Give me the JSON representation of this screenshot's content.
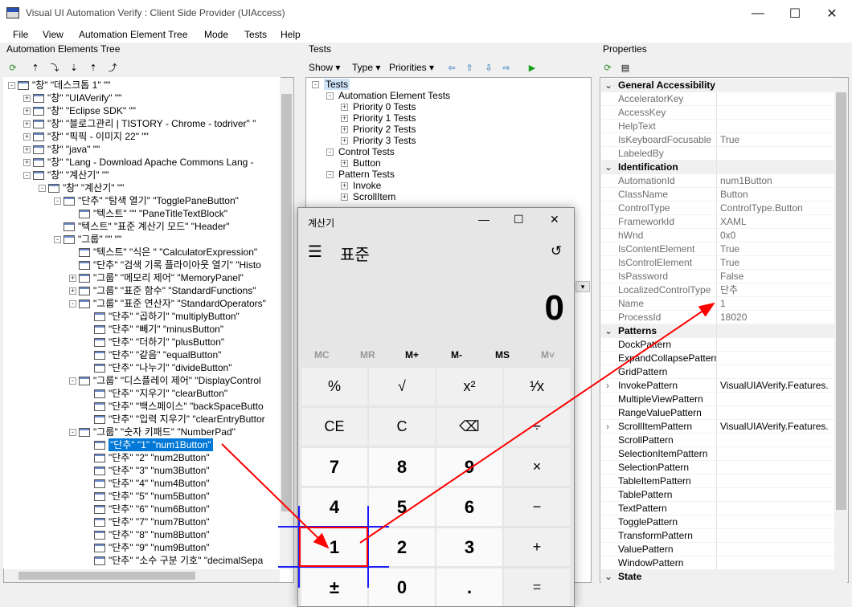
{
  "window": {
    "title": "Visual UI Automation Verify : Client Side Provider (UIAccess)"
  },
  "menu": [
    "File",
    "View",
    "Automation Element Tree",
    "Mode",
    "Tests",
    "Help"
  ],
  "panes": {
    "tree_title": "Automation Elements Tree",
    "tests_title": "Tests",
    "props_title": "Properties"
  },
  "tests_toolbar": {
    "show": "Show",
    "type": "Type",
    "priorities": "Priorities"
  },
  "tree": [
    {
      "text": "\"창\" \"데스크톱 1\" \"\"",
      "level": 0,
      "exp": "-"
    },
    {
      "text": "\"창\" \"UIAVerify\" \"\"",
      "level": 1,
      "exp": "+"
    },
    {
      "text": "\"창\" \"Eclipse SDK\" \"\"",
      "level": 1,
      "exp": "+"
    },
    {
      "text": "\"창\" \"블로그관리 | TISTORY - Chrome - todriver\" \"",
      "level": 1,
      "exp": "+"
    },
    {
      "text": "\"창\" \"픽픽 - 이미지 22\" \"\"",
      "level": 1,
      "exp": "+"
    },
    {
      "text": "\"창\" \"java\" \"\"",
      "level": 1,
      "exp": "+"
    },
    {
      "text": "\"창\" \"Lang - Download Apache Commons Lang -",
      "level": 1,
      "exp": "+"
    },
    {
      "text": "\"창\" \"계산기\" \"\"",
      "level": 1,
      "exp": "-"
    },
    {
      "text": "\"창\" \"계산기\" \"\"",
      "level": 2,
      "exp": "-"
    },
    {
      "text": "\"단추\" \"탐색 열기\" \"TogglePaneButton\"",
      "level": 3,
      "exp": "-"
    },
    {
      "text": "\"텍스트\" \"\" \"PaneTitleTextBlock\"",
      "level": 4,
      "exp": ""
    },
    {
      "text": "\"텍스트\" \"표준 계산기 모드\" \"Header\"",
      "level": 3,
      "exp": ""
    },
    {
      "text": "\"그룹\" \"\" \"\"",
      "level": 3,
      "exp": "-"
    },
    {
      "text": "\"텍스트\" \"식은 \" \"CalculatorExpression\"",
      "level": 4,
      "exp": ""
    },
    {
      "text": "\"단추\" \"검색 기록 플라이아웃 열기\" \"Histo",
      "level": 4,
      "exp": ""
    },
    {
      "text": "\"그룹\" \"메모리 제어\" \"MemoryPanel\"",
      "level": 4,
      "exp": "+"
    },
    {
      "text": "\"그룹\" \"표준 함수\" \"StandardFunctions\"",
      "level": 4,
      "exp": "+"
    },
    {
      "text": "\"그룹\" \"표준 연산자\" \"StandardOperators\"",
      "level": 4,
      "exp": "-"
    },
    {
      "text": "\"단추\" \"곱하기\" \"multiplyButton\"",
      "level": 5,
      "exp": ""
    },
    {
      "text": "\"단추\" \"빼기\" \"minusButton\"",
      "level": 5,
      "exp": ""
    },
    {
      "text": "\"단추\" \"더하기\" \"plusButton\"",
      "level": 5,
      "exp": ""
    },
    {
      "text": "\"단추\" \"같음\" \"equalButton\"",
      "level": 5,
      "exp": ""
    },
    {
      "text": "\"단추\" \"나누기\" \"divideButton\"",
      "level": 5,
      "exp": ""
    },
    {
      "text": "\"그룹\" \"디스플레이 제어\" \"DisplayControl",
      "level": 4,
      "exp": "-"
    },
    {
      "text": "\"단추\" \"지우기\" \"clearButton\"",
      "level": 5,
      "exp": ""
    },
    {
      "text": "\"단추\" \"백스페이스\" \"backSpaceButto",
      "level": 5,
      "exp": ""
    },
    {
      "text": "\"단추\" \"입력 지우기\" \"clearEntryButtor",
      "level": 5,
      "exp": ""
    },
    {
      "text": "\"그룹\" \"숫자 키패드\" \"NumberPad\"",
      "level": 4,
      "exp": "-"
    },
    {
      "text": "\"단추\" \"1\" \"num1Button\"",
      "level": 5,
      "exp": "",
      "selected": true
    },
    {
      "text": "\"단추\" \"2\" \"num2Button\"",
      "level": 5,
      "exp": ""
    },
    {
      "text": "\"단추\" \"3\" \"num3Button\"",
      "level": 5,
      "exp": ""
    },
    {
      "text": "\"단추\" \"4\" \"num4Button\"",
      "level": 5,
      "exp": ""
    },
    {
      "text": "\"단추\" \"5\" \"num5Button\"",
      "level": 5,
      "exp": ""
    },
    {
      "text": "\"단추\" \"6\" \"num6Button\"",
      "level": 5,
      "exp": ""
    },
    {
      "text": "\"단추\" \"7\" \"num7Button\"",
      "level": 5,
      "exp": ""
    },
    {
      "text": "\"단추\" \"8\" \"num8Button\"",
      "level": 5,
      "exp": ""
    },
    {
      "text": "\"단추\" \"9\" \"num9Button\"",
      "level": 5,
      "exp": ""
    },
    {
      "text": "\"단추\" \"소수 구분 기호\" \"decimalSepa",
      "level": 5,
      "exp": ""
    }
  ],
  "tests_tree": [
    {
      "text": "Tests",
      "level": 0,
      "exp": "-",
      "selected": true
    },
    {
      "text": "Automation Element Tests",
      "level": 1,
      "exp": "-"
    },
    {
      "text": "Priority 0 Tests",
      "level": 2,
      "exp": "+"
    },
    {
      "text": "Priority 1 Tests",
      "level": 2,
      "exp": "+"
    },
    {
      "text": "Priority 2 Tests",
      "level": 2,
      "exp": "+"
    },
    {
      "text": "Priority 3 Tests",
      "level": 2,
      "exp": "+"
    },
    {
      "text": "Control Tests",
      "level": 1,
      "exp": "-"
    },
    {
      "text": "Button",
      "level": 2,
      "exp": "+"
    },
    {
      "text": "Pattern Tests",
      "level": 1,
      "exp": "-"
    },
    {
      "text": "Invoke",
      "level": 2,
      "exp": "+"
    },
    {
      "text": "ScrollItem",
      "level": 2,
      "exp": "+"
    }
  ],
  "properties": [
    {
      "cat": "General Accessibility",
      "chev": "⌄"
    },
    {
      "name": "AcceleratorKey",
      "value": ""
    },
    {
      "name": "AccessKey",
      "value": ""
    },
    {
      "name": "HelpText",
      "value": ""
    },
    {
      "name": "IsKeyboardFocusable",
      "value": "True"
    },
    {
      "name": "LabeledBy",
      "value": ""
    },
    {
      "cat": "Identification",
      "chev": "⌄"
    },
    {
      "name": "AutomationId",
      "value": "num1Button"
    },
    {
      "name": "ClassName",
      "value": "Button"
    },
    {
      "name": "ControlType",
      "value": "ControlType.Button"
    },
    {
      "name": "FrameworkId",
      "value": "XAML"
    },
    {
      "name": "hWnd",
      "value": "0x0"
    },
    {
      "name": "IsContentElement",
      "value": "True"
    },
    {
      "name": "IsControlElement",
      "value": "True"
    },
    {
      "name": "IsPassword",
      "value": "False"
    },
    {
      "name": "LocalizedControlType",
      "value": "단추"
    },
    {
      "name": "Name",
      "value": "1"
    },
    {
      "name": "ProcessId",
      "value": "18020"
    },
    {
      "cat": "Patterns",
      "chev": "⌄"
    },
    {
      "name": "DockPattern",
      "value": "",
      "on": true
    },
    {
      "name": "ExpandCollapsePattern",
      "value": "",
      "on": true
    },
    {
      "name": "GridPattern",
      "value": "",
      "on": true
    },
    {
      "name": "InvokePattern",
      "value": "VisualUIAVerify.Features.",
      "on": true,
      "chev": "›"
    },
    {
      "name": "MultipleViewPattern",
      "value": "",
      "on": true
    },
    {
      "name": "RangeValuePattern",
      "value": "",
      "on": true
    },
    {
      "name": "ScrollItemPattern",
      "value": "VisualUIAVerify.Features.",
      "on": true,
      "chev": "›"
    },
    {
      "name": "ScrollPattern",
      "value": "",
      "on": true
    },
    {
      "name": "SelectionItemPattern",
      "value": "",
      "on": true
    },
    {
      "name": "SelectionPattern",
      "value": "",
      "on": true
    },
    {
      "name": "TableItemPattern",
      "value": "",
      "on": true
    },
    {
      "name": "TablePattern",
      "value": "",
      "on": true
    },
    {
      "name": "TextPattern",
      "value": "",
      "on": true
    },
    {
      "name": "TogglePattern",
      "value": "",
      "on": true
    },
    {
      "name": "TransformPattern",
      "value": "",
      "on": true
    },
    {
      "name": "ValuePattern",
      "value": "",
      "on": true
    },
    {
      "name": "WindowPattern",
      "value": "",
      "on": true
    },
    {
      "cat": "State",
      "chev": "⌄"
    }
  ],
  "calculator": {
    "title": "계산기",
    "mode": "표준",
    "display": "0",
    "memory": [
      "MC",
      "MR",
      "M+",
      "M-",
      "MS",
      "M˅"
    ],
    "rows": [
      [
        "%",
        "√",
        "x²",
        "¹⁄x"
      ],
      [
        "CE",
        "C",
        "⌫",
        "÷"
      ],
      [
        "7",
        "8",
        "9",
        "×"
      ],
      [
        "4",
        "5",
        "6",
        "−"
      ],
      [
        "1",
        "2",
        "3",
        "+"
      ],
      [
        "±",
        "0",
        ".",
        "="
      ]
    ]
  },
  "colors": {
    "selection": "#0078d7",
    "arrow": "#ff0000",
    "crosshair": "#1a1aff"
  }
}
